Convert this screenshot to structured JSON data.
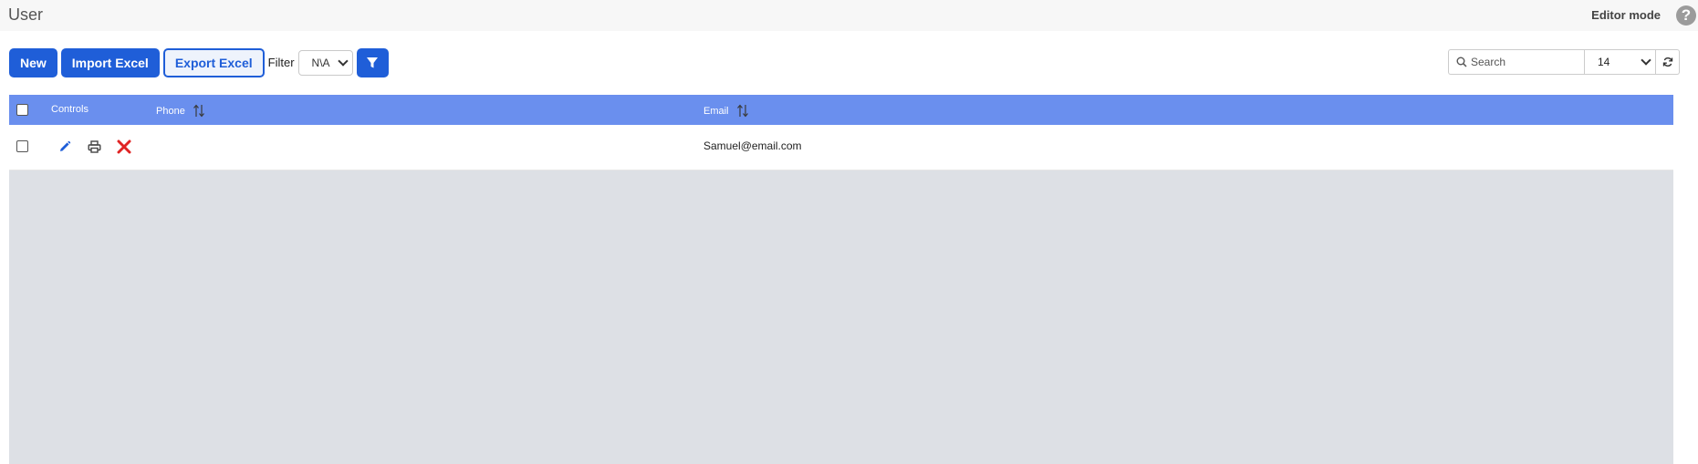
{
  "header": {
    "title": "User",
    "editor_mode_label": "Editor mode",
    "help_glyph": "?"
  },
  "toolbar": {
    "new_label": "New",
    "import_label": "Import Excel",
    "export_label": "Export Excel",
    "filter_label": "Filter",
    "filter_value": "N\\A",
    "filter_icon": "funnel-icon"
  },
  "search": {
    "placeholder": "Search",
    "page_size": "14",
    "refresh_icon": "refresh-icon"
  },
  "grid": {
    "columns": {
      "controls": "Controls",
      "phone": "Phone",
      "email": "Email"
    },
    "rows": [
      {
        "phone": "",
        "email": "Samuel@email.com"
      }
    ]
  },
  "colors": {
    "primary": "#1f5ed8",
    "header_bg": "#6a8fee",
    "delete": "#e02424",
    "empty_area": "#dde0e5"
  }
}
